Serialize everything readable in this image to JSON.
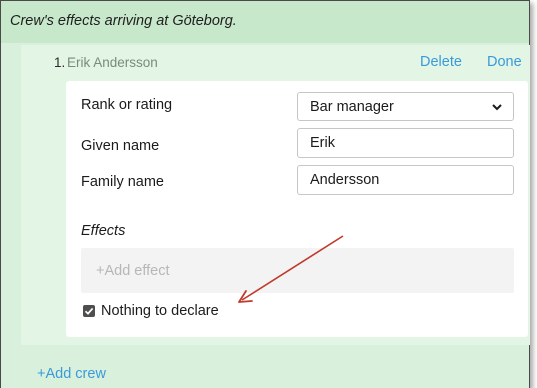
{
  "header": {
    "title": "Crew's effects arriving at Göteborg."
  },
  "crew_member": {
    "number": "1.",
    "name": "Erik Andersson",
    "delete_label": "Delete",
    "done_label": "Done"
  },
  "form": {
    "rank": {
      "label": "Rank or rating",
      "value": "Bar manager"
    },
    "given_name": {
      "label": "Given name",
      "value": "Erik"
    },
    "family_name": {
      "label": "Family name",
      "value": "Andersson"
    }
  },
  "effects": {
    "heading": "Effects",
    "add_label": "+Add effect",
    "nothing_to_declare": {
      "label": "Nothing to declare",
      "checked": true
    }
  },
  "add_crew_label": "+Add crew",
  "colors": {
    "panel_bg": "#d9f1dc",
    "link": "#3a9ad9",
    "annotation_arrow": "#c0392b"
  }
}
